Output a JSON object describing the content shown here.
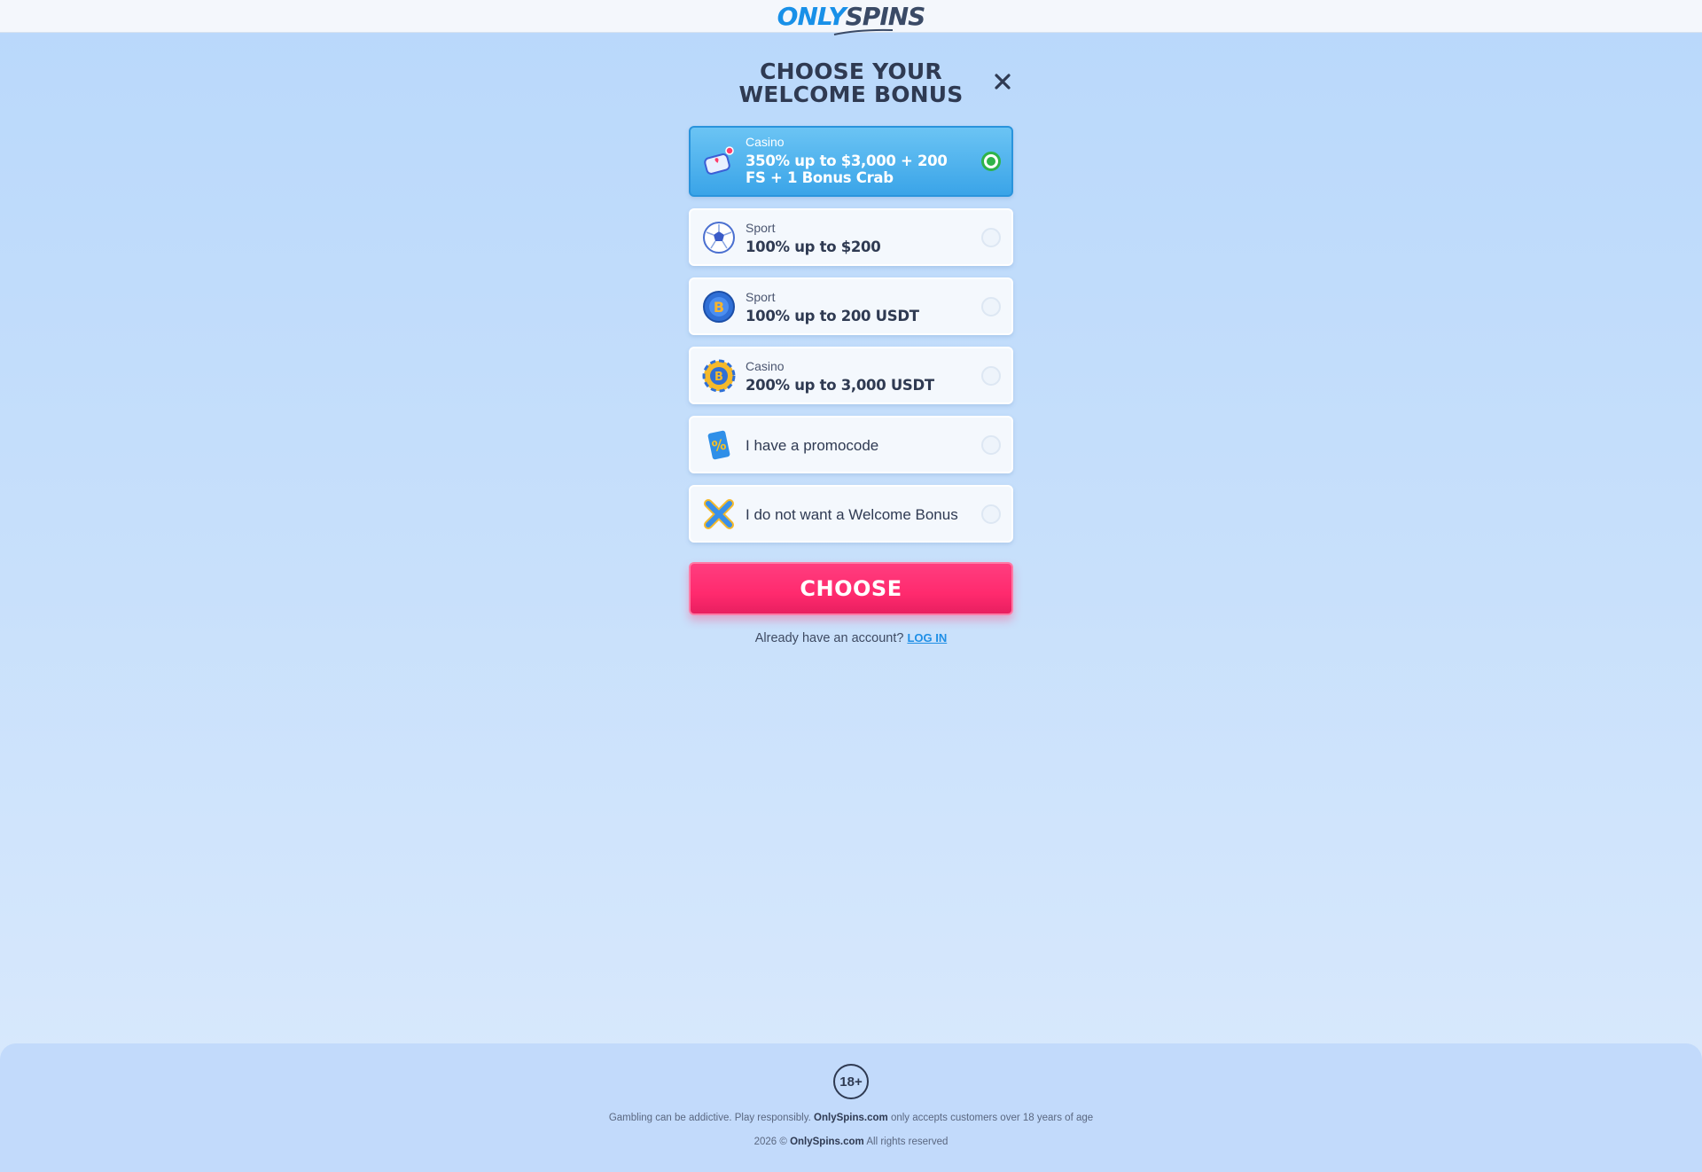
{
  "header": {
    "logo_part1": "ONLY",
    "logo_part2": "SPINS"
  },
  "modal": {
    "title_line1": "CHOOSE YOUR",
    "title_line2": "WELCOME BONUS",
    "close_icon": "close-icon",
    "options": [
      {
        "category": "Casino",
        "title": "350% up to $3,000 + 200 FS + 1 Bonus Crab",
        "icon": "casino-gift-icon",
        "selected": true
      },
      {
        "category": "Sport",
        "title": "100% up to $200",
        "icon": "soccer-ball-icon",
        "selected": false
      },
      {
        "category": "Sport",
        "title": "100% up to 200 USDT",
        "icon": "bitcoin-coin-icon",
        "selected": false
      },
      {
        "category": "Casino",
        "title": "200% up to 3,000 USDT",
        "icon": "crypto-chip-icon",
        "selected": false
      },
      {
        "label": "I have a promocode",
        "icon": "percent-ticket-icon",
        "selected": false
      },
      {
        "label": "I do not want a Welcome Bonus",
        "icon": "x-mark-icon",
        "selected": false
      }
    ],
    "choose_label": "CHOOSE",
    "login_prompt": "Already have an account?",
    "login_link": "LOG IN"
  },
  "footer": {
    "age_badge": "18+",
    "line1_pre": "Gambling can be addictive. Play responsibly.",
    "line1_brand": "OnlySpins.com",
    "line1_post": "only accepts customers over 18 years of age",
    "line2_pre": "2026 ©",
    "line2_brand": "OnlySpins.com",
    "line2_post": "All rights reserved"
  },
  "colors": {
    "accent_blue": "#1890e8",
    "selected_bg": "#3aa4e8",
    "cta_pink": "#ff2a6e",
    "radio_green": "#2fb34a",
    "text_dark": "#2f3a52"
  }
}
